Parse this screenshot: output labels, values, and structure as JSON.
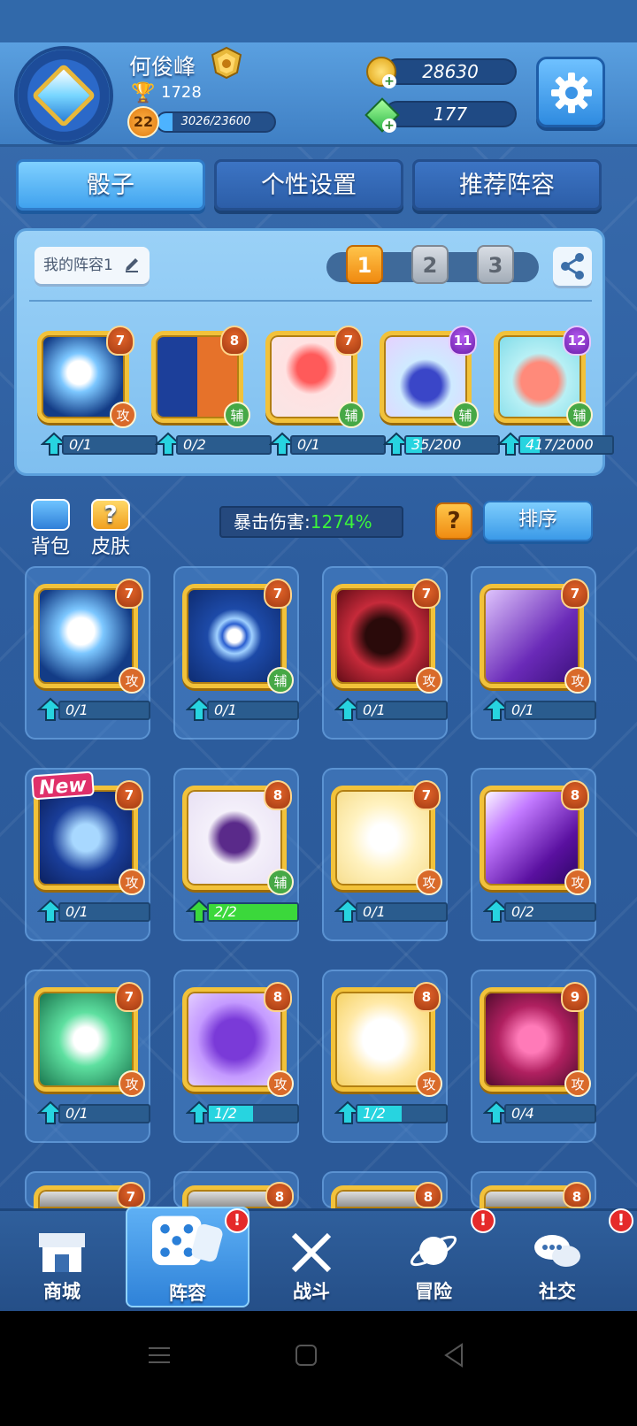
{
  "player": {
    "name": "何俊峰",
    "trophies": "1728",
    "level": "22",
    "xp_text": "3026/23600",
    "xp_fraction": 0.128
  },
  "currency": {
    "gold": "28630",
    "gems": "177"
  },
  "tabs": [
    {
      "label": "骰子",
      "active": true
    },
    {
      "label": "个性设置",
      "active": false
    },
    {
      "label": "推荐阵容",
      "active": false
    }
  ],
  "deck": {
    "name": "我的阵容1",
    "slots": [
      "1",
      "2",
      "3"
    ],
    "active_slot": "1",
    "cards": [
      {
        "level": "7",
        "type": "攻",
        "progress": "0/1",
        "fill": 0,
        "art": "ghost-spirit"
      },
      {
        "level": "8",
        "type": "辅",
        "progress": "0/2",
        "fill": 0,
        "art": "silhouette-figures"
      },
      {
        "level": "7",
        "type": "辅",
        "progress": "0/1",
        "fill": 0,
        "art": "red-drum"
      },
      {
        "level": "11",
        "type": "辅",
        "progress": "35/200",
        "fill": 0.175,
        "art": "magic-hat"
      },
      {
        "level": "12",
        "type": "辅",
        "progress": "417/2000",
        "fill": 0.2085,
        "art": "piggy-bank"
      }
    ]
  },
  "tools": {
    "backpack": "背包",
    "skins": "皮肤",
    "crit_label": "暴击伤害:",
    "crit_value": "1274%",
    "help": "?",
    "sort": "排序"
  },
  "collection": [
    {
      "level": "7",
      "type": "攻",
      "progress": "0/1",
      "fill": 0,
      "art": "ghost-spirit",
      "new": false
    },
    {
      "level": "7",
      "type": "辅",
      "progress": "0/1",
      "fill": 0,
      "art": "spinning-s",
      "new": false
    },
    {
      "level": "7",
      "type": "攻",
      "progress": "0/1",
      "fill": 0,
      "art": "vampire",
      "new": false
    },
    {
      "level": "7",
      "type": "攻",
      "progress": "0/1",
      "fill": 0,
      "art": "archer",
      "new": false
    },
    {
      "level": "7",
      "type": "攻",
      "progress": "0/1",
      "fill": 0,
      "art": "scorpion",
      "new": true
    },
    {
      "level": "8",
      "type": "辅",
      "progress": "2/2",
      "fill": 1,
      "art": "witch-hat",
      "new": false
    },
    {
      "level": "7",
      "type": "攻",
      "progress": "0/1",
      "fill": 0,
      "art": "holy-cross",
      "new": false
    },
    {
      "level": "8",
      "type": "攻",
      "progress": "0/2",
      "fill": 0,
      "art": "purple-blade",
      "new": false
    },
    {
      "level": "7",
      "type": "攻",
      "progress": "0/1",
      "fill": 0,
      "art": "green-ghost",
      "new": false
    },
    {
      "level": "8",
      "type": "攻",
      "progress": "1/2",
      "fill": 0.5,
      "art": "purple-blob",
      "new": false
    },
    {
      "level": "8",
      "type": "攻",
      "progress": "1/2",
      "fill": 0.5,
      "art": "panda",
      "new": false
    },
    {
      "level": "9",
      "type": "攻",
      "progress": "0/4",
      "fill": 0,
      "art": "lotus",
      "new": false
    },
    {
      "level": "7",
      "type": "",
      "progress": "",
      "fill": 0,
      "art": "partial",
      "new": false
    },
    {
      "level": "8",
      "type": "",
      "progress": "",
      "fill": 0,
      "art": "partial",
      "new": false
    },
    {
      "level": "8",
      "type": "",
      "progress": "",
      "fill": 0,
      "art": "partial",
      "new": false
    },
    {
      "level": "8",
      "type": "",
      "progress": "",
      "fill": 0,
      "art": "partial",
      "new": false
    }
  ],
  "new_tag": "New",
  "bottom_nav": [
    {
      "label": "商城",
      "icon": "shop-icon",
      "active": false,
      "alert": false
    },
    {
      "label": "阵容",
      "icon": "dice-icon",
      "active": true,
      "alert": true
    },
    {
      "label": "战斗",
      "icon": "crossed-swords-icon",
      "active": false,
      "alert": false
    },
    {
      "label": "冒险",
      "icon": "planet-icon",
      "active": false,
      "alert": true
    },
    {
      "label": "社交",
      "icon": "chat-bubbles-icon",
      "active": false,
      "alert": true
    }
  ],
  "alert_mark": "!",
  "colors": {
    "header": "#4a90d8",
    "active_tab": "#5cb8f5",
    "card_border": "#f2c23a",
    "attack_badge": "#d96a2a",
    "support_badge": "#46a846",
    "crit_value": "#3bf53b",
    "alert": "#e52a2a"
  }
}
